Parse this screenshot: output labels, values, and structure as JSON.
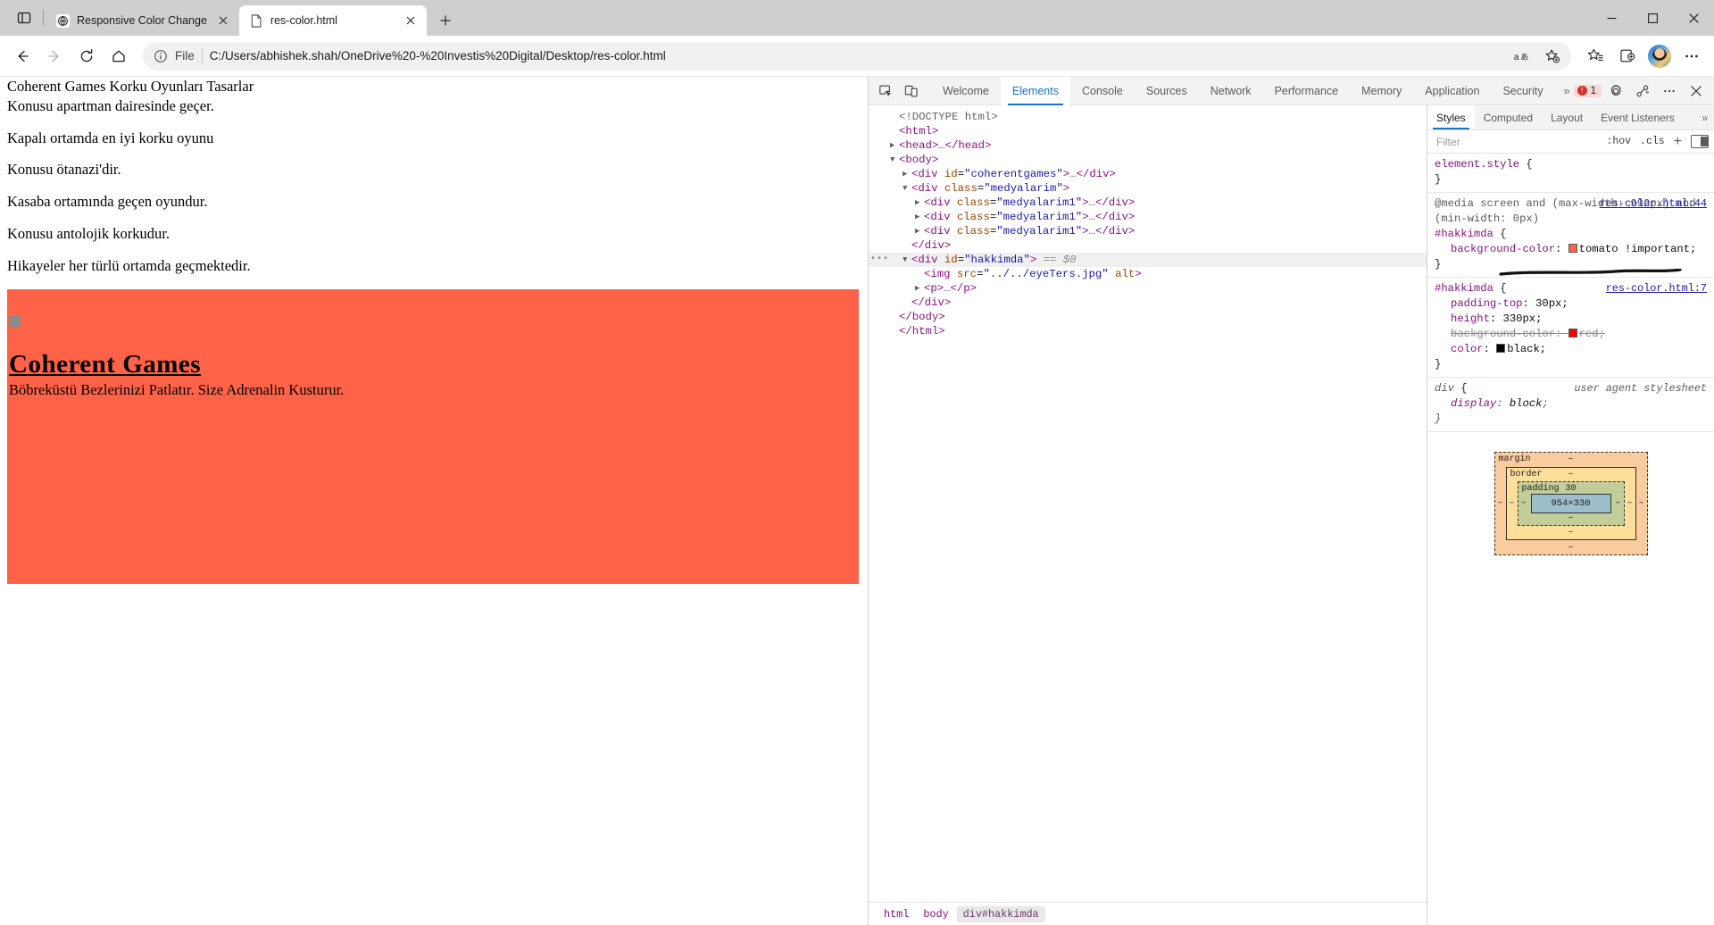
{
  "browser": {
    "tabs": [
      {
        "title": "Responsive Color Change",
        "favicon": "globe-icon",
        "active": false
      },
      {
        "title": "res-color.html",
        "favicon": "page-icon",
        "active": true
      }
    ],
    "newtab_tooltip": "New tab",
    "window_controls": {
      "minimize": "—",
      "maximize": "☐",
      "close": "✕"
    },
    "address": {
      "scheme_label": "File",
      "url": "C:/Users/abhishek.shah/OneDrive%20-%20Investis%20Digital/Desktop/res-color.html"
    },
    "nav": {
      "back": "back-icon",
      "forward": "forward-icon",
      "reload": "reload-icon",
      "home": "home-icon"
    },
    "toolbar_icons": [
      "read-aloud-icon",
      "add-favorite-icon",
      "favorites-icon",
      "collections-icon",
      "profile-avatar",
      "settings-more-icon"
    ]
  },
  "page": {
    "lines": [
      "Coherent Games Korku Oyunları Tasarlar",
      "Konusu apartman dairesinde geçer.",
      "Kapalı ortamda en iyi korku oyunu",
      "Konusu ötanazi'dir.",
      "Kasaba ortamında geçen oyundur.",
      "Konusu antolojik korkudur.",
      "Hikayeler her türlü ortamda geçmektedir."
    ],
    "about": {
      "heading": "Coherent Games",
      "paragraph": "Böbreküstü Bezlerinizi Patlatır. Size Adrenalin Kusturur.",
      "background_color": "#ff6347",
      "broken_image_alt": ""
    }
  },
  "devtools": {
    "left_icons": [
      "inspect-element-icon",
      "device-toolbar-icon"
    ],
    "tabs": [
      {
        "label": "Welcome",
        "active": false
      },
      {
        "label": "Elements",
        "active": true
      },
      {
        "label": "Console",
        "active": false
      },
      {
        "label": "Sources",
        "active": false
      },
      {
        "label": "Network",
        "active": false
      },
      {
        "label": "Performance",
        "active": false
      },
      {
        "label": "Memory",
        "active": false
      },
      {
        "label": "Application",
        "active": false
      },
      {
        "label": "Security",
        "active": false
      }
    ],
    "overflow_chevron": "»",
    "error_count": "1",
    "right_icons": [
      "settings-gear-icon",
      "customize-devtools-icon",
      "more-options-icon",
      "close-devtools-icon"
    ],
    "dom": [
      {
        "indent": 1,
        "toggle": "",
        "html": "<span class=\"el\">&lt;!DOCTYPE html&gt;</span>"
      },
      {
        "indent": 1,
        "toggle": "",
        "html": "<span class=\"tg\">&lt;html&gt;</span>"
      },
      {
        "indent": 1,
        "toggle": "▶",
        "html": "<span class=\"tg\">&lt;head&gt;</span><span class=\"el\">…</span><span class=\"tg\">&lt;/head&gt;</span>"
      },
      {
        "indent": 1,
        "toggle": "▼",
        "html": "<span class=\"tg\">&lt;body&gt;</span>"
      },
      {
        "indent": 2,
        "toggle": "▶",
        "html": "<span class=\"tg\">&lt;div</span> <span class=\"at\">id</span>=<span class=\"av\">\"coherentgames\"</span><span class=\"tg\">&gt;</span><span class=\"el\">…</span><span class=\"tg\">&lt;/div&gt;</span>"
      },
      {
        "indent": 2,
        "toggle": "▼",
        "html": "<span class=\"tg\">&lt;div</span> <span class=\"at\">class</span>=<span class=\"av\">\"medyalarim\"</span><span class=\"tg\">&gt;</span>"
      },
      {
        "indent": 3,
        "toggle": "▶",
        "html": "<span class=\"tg\">&lt;div</span> <span class=\"at\">class</span>=<span class=\"av\">\"medyalarim1\"</span><span class=\"tg\">&gt;</span><span class=\"el\">…</span><span class=\"tg\">&lt;/div&gt;</span>"
      },
      {
        "indent": 3,
        "toggle": "▶",
        "html": "<span class=\"tg\">&lt;div</span> <span class=\"at\">class</span>=<span class=\"av\">\"medyalarim1\"</span><span class=\"tg\">&gt;</span><span class=\"el\">…</span><span class=\"tg\">&lt;/div&gt;</span>"
      },
      {
        "indent": 3,
        "toggle": "▶",
        "html": "<span class=\"tg\">&lt;div</span> <span class=\"at\">class</span>=<span class=\"av\">\"medyalarim1\"</span><span class=\"tg\">&gt;</span><span class=\"el\">…</span><span class=\"tg\">&lt;/div&gt;</span>"
      },
      {
        "indent": 2,
        "toggle": "",
        "html": "<span class=\"tg\">&lt;/div&gt;</span>"
      },
      {
        "indent": 2,
        "toggle": "▼",
        "selected": true,
        "html": "<span class=\"tg\">&lt;div</span> <span class=\"at\">id</span>=<span class=\"av\">\"hakkimda\"</span><span class=\"tg\">&gt;</span> <span class=\"dollar\">== $0</span>"
      },
      {
        "indent": 3,
        "toggle": "",
        "html": "<span class=\"tg\">&lt;img</span> <span class=\"at\">src</span>=<span class=\"av\">\"../../eyeTers.jpg\"</span> <span class=\"at\">alt</span><span class=\"tg\">&gt;</span>"
      },
      {
        "indent": 3,
        "toggle": "▶",
        "html": "<span class=\"tg\">&lt;p&gt;</span><span class=\"el\">…</span><span class=\"tg\">&lt;/p&gt;</span>"
      },
      {
        "indent": 2,
        "toggle": "",
        "html": "<span class=\"tg\">&lt;/div&gt;</span>"
      },
      {
        "indent": 1,
        "toggle": "",
        "html": "<span class=\"tg\">&lt;/body&gt;</span>"
      },
      {
        "indent": 1,
        "toggle": "",
        "html": "<span class=\"tg\">&lt;/html&gt;</span>"
      }
    ],
    "breadcrumbs": [
      {
        "label": "html",
        "active": false
      },
      {
        "label": "body",
        "active": false
      },
      {
        "label": "div#hakkimda",
        "active": true
      }
    ],
    "styles": {
      "tabs": [
        {
          "label": "Styles",
          "active": true
        },
        {
          "label": "Computed",
          "active": false
        },
        {
          "label": "Layout",
          "active": false
        },
        {
          "label": "Event Listeners",
          "active": false
        }
      ],
      "overflow": "»",
      "filter_placeholder": "Filter",
      "filter_value": "",
      "hov_label": ":hov",
      "cls_label": ".cls",
      "new_rule_label": "+",
      "rules": [
        {
          "name": "element-style-rule",
          "selector": "element.style",
          "source": "",
          "props": []
        },
        {
          "name": "media-hakkimda-rule",
          "media": "@media screen and (max-width: 992px) and (min-width: 0px)",
          "selector": "#hakkimda",
          "source": "res-color.html:44",
          "props": [
            {
              "key": "background-color",
              "value": "tomato !important",
              "swatch": "#ff6347",
              "struck": false
            }
          ]
        },
        {
          "name": "hakkimda-rule",
          "selector": "#hakkimda",
          "source": "res-color.html:7",
          "props": [
            {
              "key": "padding-top",
              "value": "30px",
              "swatch": "",
              "struck": false
            },
            {
              "key": "height",
              "value": "330px",
              "swatch": "",
              "struck": false
            },
            {
              "key": "background-color",
              "value": "red",
              "swatch": "#ff0000",
              "struck": true
            },
            {
              "key": "color",
              "value": "black",
              "swatch": "#000000",
              "struck": false
            }
          ]
        },
        {
          "name": "user-agent-div-rule",
          "selector": "div",
          "source": "user agent stylesheet",
          "props": [
            {
              "key": "display",
              "value": "block",
              "swatch": "",
              "struck": false
            }
          ]
        }
      ],
      "box_model": {
        "margin_label": "margin",
        "margin_top": "–",
        "margin_right": "–",
        "margin_bottom": "–",
        "margin_left": "–",
        "border_label": "border",
        "border_top": "–",
        "border_right": "–",
        "border_bottom": "–",
        "border_left": "–",
        "padding_label": "padding",
        "padding_top": "30",
        "padding_right": "–",
        "padding_bottom": "–",
        "padding_left": "–",
        "content": "954×330"
      }
    }
  }
}
